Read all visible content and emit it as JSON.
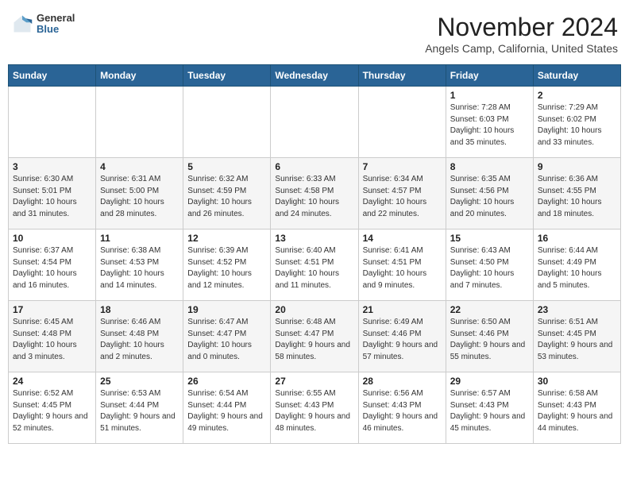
{
  "logo": {
    "general": "General",
    "blue": "Blue"
  },
  "title": "November 2024",
  "location": "Angels Camp, California, United States",
  "headers": [
    "Sunday",
    "Monday",
    "Tuesday",
    "Wednesday",
    "Thursday",
    "Friday",
    "Saturday"
  ],
  "weeks": [
    [
      {
        "day": "",
        "info": ""
      },
      {
        "day": "",
        "info": ""
      },
      {
        "day": "",
        "info": ""
      },
      {
        "day": "",
        "info": ""
      },
      {
        "day": "",
        "info": ""
      },
      {
        "day": "1",
        "info": "Sunrise: 7:28 AM\nSunset: 6:03 PM\nDaylight: 10 hours and 35 minutes."
      },
      {
        "day": "2",
        "info": "Sunrise: 7:29 AM\nSunset: 6:02 PM\nDaylight: 10 hours and 33 minutes."
      }
    ],
    [
      {
        "day": "3",
        "info": "Sunrise: 6:30 AM\nSunset: 5:01 PM\nDaylight: 10 hours and 31 minutes."
      },
      {
        "day": "4",
        "info": "Sunrise: 6:31 AM\nSunset: 5:00 PM\nDaylight: 10 hours and 28 minutes."
      },
      {
        "day": "5",
        "info": "Sunrise: 6:32 AM\nSunset: 4:59 PM\nDaylight: 10 hours and 26 minutes."
      },
      {
        "day": "6",
        "info": "Sunrise: 6:33 AM\nSunset: 4:58 PM\nDaylight: 10 hours and 24 minutes."
      },
      {
        "day": "7",
        "info": "Sunrise: 6:34 AM\nSunset: 4:57 PM\nDaylight: 10 hours and 22 minutes."
      },
      {
        "day": "8",
        "info": "Sunrise: 6:35 AM\nSunset: 4:56 PM\nDaylight: 10 hours and 20 minutes."
      },
      {
        "day": "9",
        "info": "Sunrise: 6:36 AM\nSunset: 4:55 PM\nDaylight: 10 hours and 18 minutes."
      }
    ],
    [
      {
        "day": "10",
        "info": "Sunrise: 6:37 AM\nSunset: 4:54 PM\nDaylight: 10 hours and 16 minutes."
      },
      {
        "day": "11",
        "info": "Sunrise: 6:38 AM\nSunset: 4:53 PM\nDaylight: 10 hours and 14 minutes."
      },
      {
        "day": "12",
        "info": "Sunrise: 6:39 AM\nSunset: 4:52 PM\nDaylight: 10 hours and 12 minutes."
      },
      {
        "day": "13",
        "info": "Sunrise: 6:40 AM\nSunset: 4:51 PM\nDaylight: 10 hours and 11 minutes."
      },
      {
        "day": "14",
        "info": "Sunrise: 6:41 AM\nSunset: 4:51 PM\nDaylight: 10 hours and 9 minutes."
      },
      {
        "day": "15",
        "info": "Sunrise: 6:43 AM\nSunset: 4:50 PM\nDaylight: 10 hours and 7 minutes."
      },
      {
        "day": "16",
        "info": "Sunrise: 6:44 AM\nSunset: 4:49 PM\nDaylight: 10 hours and 5 minutes."
      }
    ],
    [
      {
        "day": "17",
        "info": "Sunrise: 6:45 AM\nSunset: 4:48 PM\nDaylight: 10 hours and 3 minutes."
      },
      {
        "day": "18",
        "info": "Sunrise: 6:46 AM\nSunset: 4:48 PM\nDaylight: 10 hours and 2 minutes."
      },
      {
        "day": "19",
        "info": "Sunrise: 6:47 AM\nSunset: 4:47 PM\nDaylight: 10 hours and 0 minutes."
      },
      {
        "day": "20",
        "info": "Sunrise: 6:48 AM\nSunset: 4:47 PM\nDaylight: 9 hours and 58 minutes."
      },
      {
        "day": "21",
        "info": "Sunrise: 6:49 AM\nSunset: 4:46 PM\nDaylight: 9 hours and 57 minutes."
      },
      {
        "day": "22",
        "info": "Sunrise: 6:50 AM\nSunset: 4:46 PM\nDaylight: 9 hours and 55 minutes."
      },
      {
        "day": "23",
        "info": "Sunrise: 6:51 AM\nSunset: 4:45 PM\nDaylight: 9 hours and 53 minutes."
      }
    ],
    [
      {
        "day": "24",
        "info": "Sunrise: 6:52 AM\nSunset: 4:45 PM\nDaylight: 9 hours and 52 minutes."
      },
      {
        "day": "25",
        "info": "Sunrise: 6:53 AM\nSunset: 4:44 PM\nDaylight: 9 hours and 51 minutes."
      },
      {
        "day": "26",
        "info": "Sunrise: 6:54 AM\nSunset: 4:44 PM\nDaylight: 9 hours and 49 minutes."
      },
      {
        "day": "27",
        "info": "Sunrise: 6:55 AM\nSunset: 4:43 PM\nDaylight: 9 hours and 48 minutes."
      },
      {
        "day": "28",
        "info": "Sunrise: 6:56 AM\nSunset: 4:43 PM\nDaylight: 9 hours and 46 minutes."
      },
      {
        "day": "29",
        "info": "Sunrise: 6:57 AM\nSunset: 4:43 PM\nDaylight: 9 hours and 45 minutes."
      },
      {
        "day": "30",
        "info": "Sunrise: 6:58 AM\nSunset: 4:43 PM\nDaylight: 9 hours and 44 minutes."
      }
    ]
  ]
}
